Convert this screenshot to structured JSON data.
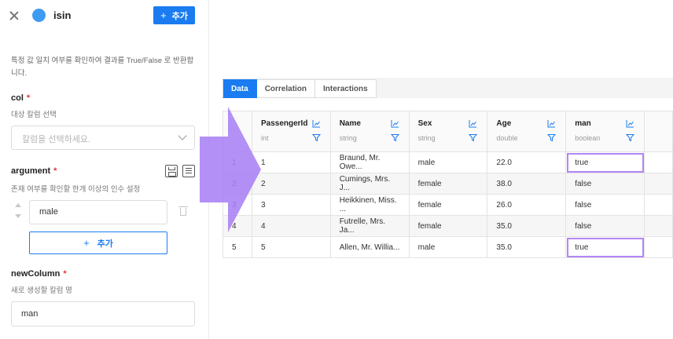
{
  "panel": {
    "title": "isin",
    "add_label": "추가",
    "description": "특정 값 일치 여부를 확인하여 결과를 True/False 로 반환합니다.",
    "col": {
      "label": "col",
      "required_mark": "*",
      "sub": "대상 칼럼 선택",
      "placeholder": "칼럼을 선택하세요."
    },
    "argument": {
      "label": "argument",
      "required_mark": "*",
      "sub": "존재 여부를 확인할 한개 이상의 인수 설정",
      "value": "male",
      "add_label": "추가"
    },
    "newColumn": {
      "label": "newColumn",
      "required_mark": "*",
      "sub": "새로 생성할 칼럼 명",
      "value": "man"
    },
    "icons": [
      "close-icon",
      "plus-icon",
      "save-icon",
      "list-icon",
      "drag-handle-icon",
      "trash-icon",
      "chevron-down-icon"
    ]
  },
  "tabs": [
    {
      "label": "Data",
      "active": true
    },
    {
      "label": "Correlation",
      "active": false
    },
    {
      "label": "Interactions",
      "active": false
    }
  ],
  "table": {
    "columns": [
      {
        "name": "PassengerId",
        "type": "int"
      },
      {
        "name": "Name",
        "type": "string"
      },
      {
        "name": "Sex",
        "type": "string"
      },
      {
        "name": "Age",
        "type": "double"
      },
      {
        "name": "man",
        "type": "boolean"
      }
    ],
    "rows": [
      {
        "index": "1",
        "cells": [
          "1",
          "Braund, Mr. Owe...",
          "male",
          "22.0",
          "true"
        ],
        "highlight": true
      },
      {
        "index": "2",
        "cells": [
          "2",
          "Cumings, Mrs. J...",
          "female",
          "38.0",
          "false"
        ],
        "highlight": false
      },
      {
        "index": "3",
        "cells": [
          "3",
          "Heikkinen, Miss. ...",
          "female",
          "26.0",
          "false"
        ],
        "highlight": false
      },
      {
        "index": "4",
        "cells": [
          "4",
          "Futrelle, Mrs. Ja...",
          "female",
          "35.0",
          "false"
        ],
        "highlight": false
      },
      {
        "index": "5",
        "cells": [
          "5",
          "Allen, Mr. Willia...",
          "male",
          "35.0",
          "true"
        ],
        "highlight": true
      }
    ]
  },
  "colors": {
    "accent": "#1a7cf0",
    "arrow": "#a981f4",
    "highlight": "#b386f5",
    "required": "#e5343c"
  }
}
